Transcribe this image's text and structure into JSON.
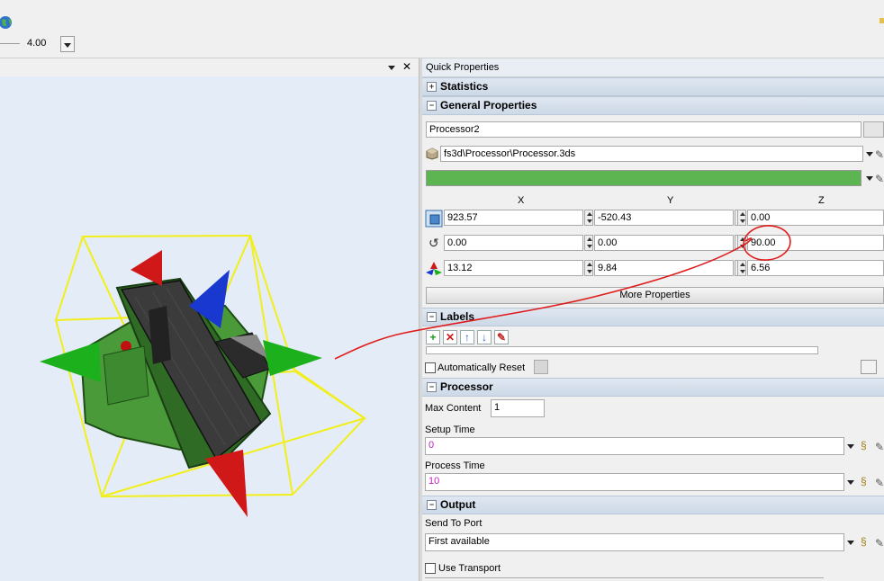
{
  "toolbar": {
    "zoom_value": "4.00"
  },
  "viewport": {
    "header_close": "✕"
  },
  "panel": {
    "title": "Quick Properties",
    "sections": {
      "statistics": "Statistics",
      "general": "General Properties",
      "labels": "Labels",
      "processor": "Processor",
      "output": "Output"
    },
    "general": {
      "name": "Processor2",
      "shape_path": "fs3d\\Processor\\Processor.3ds",
      "color": "#5db552",
      "axis_x": "X",
      "axis_y": "Y",
      "axis_z": "Z",
      "position": {
        "x": "923.57",
        "y": "-520.43",
        "z": "0.00"
      },
      "rotation": {
        "x": "0.00",
        "y": "0.00",
        "z": "90.00"
      },
      "size": {
        "x": "13.12",
        "y": "9.84",
        "z": "6.56"
      },
      "more_button": "More Properties"
    },
    "labels": {
      "auto_reset": "Automatically Reset"
    },
    "processor": {
      "max_content_label": "Max Content",
      "max_content_value": "1",
      "setup_time_label": "Setup Time",
      "setup_time_value": "0",
      "process_time_label": "Process Time",
      "process_time_value": "10"
    },
    "output": {
      "send_to_port_label": "Send To Port",
      "send_to_port_value": "First available",
      "use_transport": "Use Transport"
    }
  }
}
